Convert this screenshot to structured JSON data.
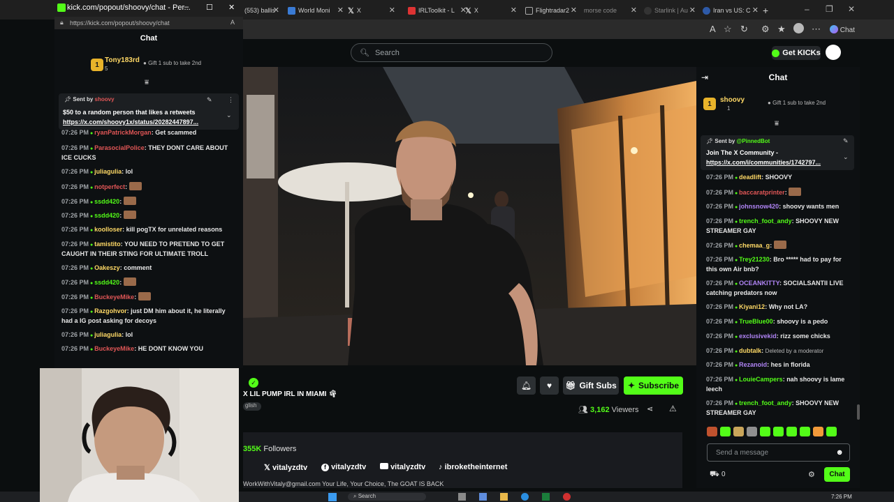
{
  "browser": {
    "tabs": [
      {
        "label": "(553) ballis"
      },
      {
        "label": "World Moni"
      },
      {
        "label": "X"
      },
      {
        "label": "IRLToolkit - L"
      },
      {
        "label": "X"
      },
      {
        "label": "Flightradar2"
      },
      {
        "label": "morse code"
      },
      {
        "label": "Starlink | Au"
      },
      {
        "label": "Iran vs US: C"
      }
    ],
    "new_tab": "+",
    "copilot_label": "Chat"
  },
  "popout": {
    "window_title": "kick.com/popout/shoovy/chat - Per...",
    "url": "https://kick.com/popout/shoovy/chat",
    "chat_title": "Chat",
    "gifter": {
      "rank": "1",
      "name": "Tony183rd",
      "count": "5",
      "gift_text": "Gift 1 sub to take 2nd"
    },
    "pinned": {
      "sent_by": "Sent by",
      "sender": "shoovy",
      "line1": "$50 to a random person that likes a retweets",
      "link": "https://x.com/shoovy1x/status/20282447897..."
    },
    "messages": [
      {
        "time": "07:26 PM",
        "user": "ryanPatrickMorgan",
        "text": "Get scammed",
        "color": "#e05656"
      },
      {
        "time": "07:26 PM",
        "user": "ParasocialPolice",
        "text": "THEY DONT CARE ABOUT ICE CUCKS",
        "color": "#e05656"
      },
      {
        "time": "07:26 PM",
        "user": "juliagulia",
        "text": "lol",
        "color": "#ffd966"
      },
      {
        "time": "07:26 PM",
        "user": "notperfect",
        "text": "",
        "color": "#e05656"
      },
      {
        "time": "07:26 PM",
        "user": "ssdd420",
        "text": "",
        "color": "#53fc18"
      },
      {
        "time": "07:26 PM",
        "user": "ssdd420",
        "text": "",
        "color": "#53fc18"
      },
      {
        "time": "07:26 PM",
        "user": "koolloser",
        "text": "kill pogTX for unrelated reasons",
        "color": "#ffd966"
      },
      {
        "time": "07:26 PM",
        "user": "tamistito",
        "text": "YOU NEED TO PRETEND TO GET CAUGHT IN THEIR STING FOR ULTIMATE TROLL",
        "color": "#ffd966"
      },
      {
        "time": "07:26 PM",
        "user": "Oakeszy",
        "text": "comment",
        "color": "#ffd966"
      },
      {
        "time": "07:26 PM",
        "user": "ssdd420",
        "text": "",
        "color": "#53fc18"
      },
      {
        "time": "07:26 PM",
        "user": "BuckeyeMike",
        "text": "",
        "color": "#e05656"
      },
      {
        "time": "07:26 PM",
        "user": "Razgohvor",
        "text": "just DM him about it, he literally had a IG post asking for decoys",
        "color": "#ffd966"
      },
      {
        "time": "07:26 PM",
        "user": "juliagulia",
        "text": "lol",
        "color": "#ffd966"
      },
      {
        "time": "07:26 PM",
        "user": "BuckeyeMike",
        "text": "HE DONT KNOW YOU",
        "color": "#e05656"
      }
    ]
  },
  "kick": {
    "search_placeholder": "Search",
    "get_kicks": "Get KICKs",
    "stream_title": "X LIL PUMP IRL IN MIAMI",
    "language_tag": "glish",
    "gift_subs": "Gift Subs",
    "subscribe": "Subscribe",
    "viewers_count": "3,162",
    "viewers_label": "Viewers",
    "followers_count": "355K",
    "followers_label": "Followers",
    "socials": [
      {
        "icon": "x-icon",
        "handle": "vitalyzdtv"
      },
      {
        "icon": "facebook-icon",
        "handle": "vitalyzdtv"
      },
      {
        "icon": "youtube-icon",
        "handle": "vitalyzdtv"
      },
      {
        "icon": "tiktok-icon",
        "handle": "ibroketheinternet"
      }
    ],
    "about_line": "WorkWithVitaly@gmail.com Your Life, Your Choice, The GOAT IS BACK",
    "accent": "#53fc18"
  },
  "chat": {
    "title": "Chat",
    "gifter": {
      "rank": "1",
      "name": "shoovy",
      "count": "1",
      "gift_text": "Gift 1 sub to take 2nd"
    },
    "pinned": {
      "sent_by": "Sent by",
      "sender": "@PinnedBot",
      "line1": "Join The X Community -",
      "link": "https://x.com/i/communities/1742797..."
    },
    "messages": [
      {
        "time": "07:26 PM",
        "user": "deadlift",
        "text": "SHOOVY",
        "color": "#ffd966"
      },
      {
        "time": "07:26 PM",
        "user": "baccaratprinter",
        "text": "",
        "color": "#e05656"
      },
      {
        "time": "07:26 PM",
        "user": "johnsnow420",
        "text": "shoovy wants men",
        "color": "#b084f5"
      },
      {
        "time": "07:26 PM",
        "user": "trench_foot_andy",
        "text": "SHOOVY NEW STREAMER GAY",
        "color": "#53fc18"
      },
      {
        "time": "07:26 PM",
        "user": "chemaa_g",
        "text": "",
        "color": "#ffd966"
      },
      {
        "time": "07:26 PM",
        "user": "Trey21230",
        "text": "Bro ***** had to pay for this own Air bnb?",
        "color": "#53fc18"
      },
      {
        "time": "07:26 PM",
        "user": "OCEANKITTY",
        "text": "SOCIALSANTII LIVE catching predators now",
        "color": "#b084f5"
      },
      {
        "time": "07:26 PM",
        "user": "Kiyani12",
        "text": "Why not LA?",
        "color": "#ffd966"
      },
      {
        "time": "07:26 PM",
        "user": "TrueBlue00",
        "text": "shoovy is a pedo",
        "color": "#53fc18"
      },
      {
        "time": "07:26 PM",
        "user": "exclusivekid",
        "text": "rizz some chicks",
        "color": "#b084f5"
      },
      {
        "time": "07:26 PM",
        "user": "dubtalk",
        "text": "Deleted by a moderator",
        "color": "#ffd966"
      },
      {
        "time": "07:26 PM",
        "user": "Rezanoid",
        "text": "hes in florida",
        "color": "#b084f5"
      },
      {
        "time": "07:26 PM",
        "user": "LouieCampers",
        "text": "nah shoovy is lame leech",
        "color": "#53fc18"
      },
      {
        "time": "07:26 PM",
        "user": "trench_foot_andy",
        "text": "SHOOVY NEW STREAMER GAY",
        "color": "#53fc18"
      }
    ],
    "input_placeholder": "Send a message",
    "kicks_balance": "0",
    "send_label": "Chat"
  },
  "taskbar": {
    "search": "Search",
    "time": "7:26 PM"
  }
}
